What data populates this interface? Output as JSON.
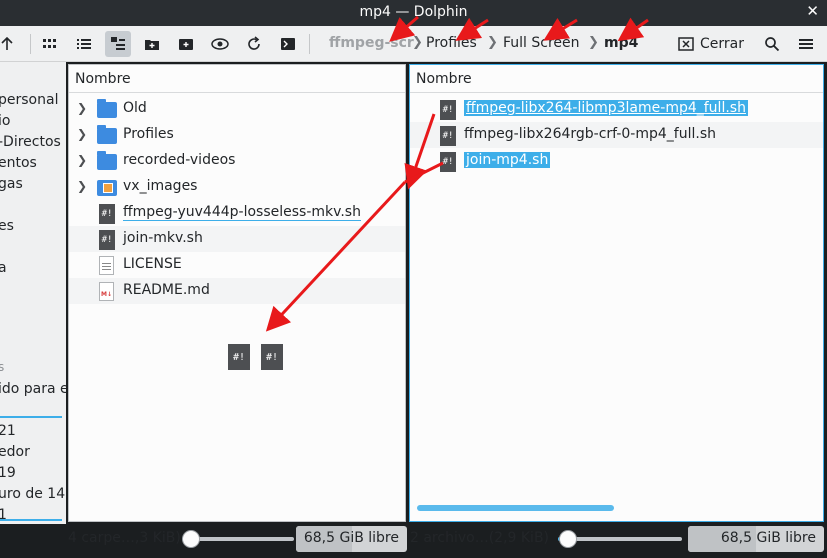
{
  "window": {
    "title": "mp4 — Dolphin",
    "close_glyph": "✕"
  },
  "toolbar": {
    "breadcrumbs": [
      "ffmpeg-scr",
      "Profiles",
      "Full Screen",
      "mp4"
    ],
    "close_label": "Cerrar"
  },
  "places": {
    "items": [
      "personal",
      "io",
      "-Directos",
      "entos",
      "gas",
      "es",
      "a",
      "s",
      "ido para e",
      "21",
      "edor",
      "19",
      "uro de 14(",
      "1"
    ]
  },
  "left_pane": {
    "header": "Nombre",
    "rows": [
      {
        "name": "Old",
        "icon": "folder-icon"
      },
      {
        "name": "Profiles",
        "icon": "folder-icon"
      },
      {
        "name": "recorded-videos",
        "icon": "folder-icon"
      },
      {
        "name": "vx_images",
        "icon": "image-folder-icon"
      },
      {
        "name": "ffmpeg-yuv444p-losseless-mkv.sh",
        "icon": "shell-script-icon"
      },
      {
        "name": "join-mkv.sh",
        "icon": "shell-script-icon"
      },
      {
        "name": "LICENSE",
        "icon": "text-document-icon"
      },
      {
        "name": "README.md",
        "icon": "markdown-document-icon"
      }
    ],
    "status": "4 carpe…,3 KiB)",
    "free_space": "68,5 GiB libre",
    "zoom_fraction": 0.08,
    "free_fraction": 0.5
  },
  "right_pane": {
    "header": "Nombre",
    "rows": [
      {
        "name": "ffmpeg-libx264-libmp3lame-mp4_full.sh",
        "icon": "shell-script-icon",
        "selected": true
      },
      {
        "name": "ffmpeg-libx264rgb-crf-0-mp4_full.sh",
        "icon": "shell-script-icon",
        "selected": false
      },
      {
        "name": "join-mp4.sh",
        "icon": "shell-script-icon",
        "selected": true
      }
    ],
    "status": "2 archivo…(2,9 KiB)",
    "free_space": "68,5 GiB libre",
    "zoom_fraction": 0.08,
    "free_fraction": 0.5
  },
  "drag_icons": [
    "shell-script-icon",
    "shell-script-icon"
  ],
  "icon_glyph": "#!",
  "colors": {
    "accent": "#3daee9",
    "annotation": "#e8191b",
    "folder": "#3d8be0"
  }
}
